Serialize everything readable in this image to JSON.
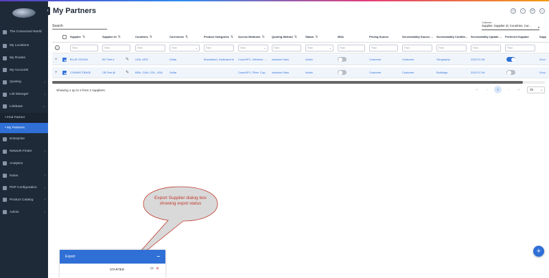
{
  "sidebar": {
    "items": [
      {
        "label": "The Connected World",
        "icon": "globe-icon"
      },
      {
        "label": "My Locations",
        "icon": "location-icon"
      },
      {
        "label": "My Routes",
        "icon": "route-icon"
      },
      {
        "label": "My Accounts",
        "icon": "accounts-icon"
      },
      {
        "label": "Quoting",
        "icon": "quote-icon",
        "chev": "›"
      },
      {
        "label": "List Manager",
        "icon": "list-icon",
        "chev": "›"
      },
      {
        "label": "Linkbase",
        "icon": "link-icon",
        "chev": "⌄"
      }
    ],
    "sub": [
      {
        "label": "• Find Partner"
      },
      {
        "label": "• My Partners"
      }
    ],
    "items2": [
      {
        "label": "Enterprise",
        "icon": "enterprise-icon"
      },
      {
        "label": "Network Finder",
        "icon": "network-icon",
        "chev": "›"
      },
      {
        "label": "Analytics",
        "icon": "analytics-icon"
      },
      {
        "label": "Rules",
        "icon": "rules-icon",
        "chev": "›"
      },
      {
        "label": "PDP Configuration",
        "icon": "config-icon",
        "chev": "›"
      },
      {
        "label": "Product Catalog",
        "icon": "catalog-icon",
        "chev": "›"
      },
      {
        "label": "Admin",
        "icon": "admin-icon",
        "chev": "›"
      }
    ]
  },
  "header": {
    "title": "My Partners"
  },
  "search": {
    "label": "Search"
  },
  "columns_select": {
    "label": "Columns",
    "value": "Supplier, Supplier Id, Countries, Cur..."
  },
  "table": {
    "headers": [
      "Supplier",
      "Supplier Id",
      "Countries",
      "Currencies",
      "Product Categories",
      "Access Mediums",
      "Quoting Method",
      "Status",
      "MSA",
      "Pricing Source",
      "Serviceability Source ...",
      "Serviceability Confide...",
      "Serviceability Update ...",
      "Preferred Supplier",
      "Supp"
    ],
    "filter_placeholder": "Filter",
    "rows": [
      {
        "supplier": "BLUE OCEAN",
        "supplier_id": "BO Test #",
        "countries": "USA, ARG",
        "currencies": "Dollar",
        "product_categories": "Broadband, Dedicated In",
        "access_mediums": "Coax/HFC, Wireless - ...",
        "quoting_method": "Instance Data",
        "status": "Active",
        "msa": false,
        "pricing_source": "Customer",
        "serv_source": "Customer",
        "serv_confidence": "Geography",
        "serv_update": "2022-07-06",
        "preferred": true,
        "supp": "Grou"
      },
      {
        "supplier": "CONNECTBASE",
        "supplier_id": "CB Test @",
        "countries": "BRA, CAN, COL, USA",
        "currencies": "Dollar",
        "product_categories": "",
        "access_mediums": "Coax/HFC, Fiber, Cop...",
        "quoting_method": "Instance Data",
        "status": "Active",
        "msa": false,
        "pricing_source": "Customer",
        "serv_source": "Customer",
        "serv_confidence": "Buildings",
        "serv_update": "2022-07-06",
        "preferred": false,
        "supp": "Grou"
      }
    ]
  },
  "footer": {
    "summary": "Showing 1 up to 2 from 2 suppliers.",
    "page": "1",
    "page_size": "25"
  },
  "callout": {
    "text": "Export Supplier dialog box showing expot status"
  },
  "export": {
    "title": "Export",
    "minimize": "−",
    "status": "STARTED"
  },
  "fab": {
    "label": "+"
  }
}
